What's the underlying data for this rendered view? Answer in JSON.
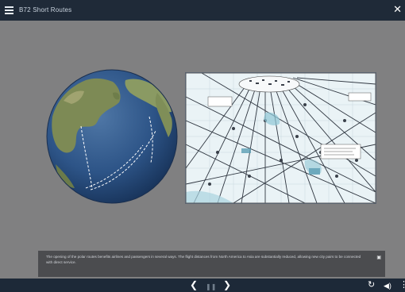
{
  "titlebar": {
    "title": "B72 Short Routes",
    "menu_icon": "hamburger-menu-icon",
    "close_icon": "close-icon",
    "close_glyph": "✕",
    "background": "#1f2a38"
  },
  "stage": {
    "background": "#808081",
    "globe": {
      "icon": "globe-pacific-routes-illustration"
    },
    "chart": {
      "icon": "polar-route-navigation-chart"
    }
  },
  "caption": {
    "text": "The opening of the polar routes benefits airlines and passengers in several ways. The flight distances from North America to Asia are substantially reduced, allowing new city pairs to be connected with direct service.",
    "icon": "transcript-icon",
    "icon_glyph": "▣"
  },
  "bottombar": {
    "prev_glyph": "❮",
    "pause_glyph": "❚❚",
    "next_glyph": "❯",
    "reload_glyph": "↻",
    "volume_glyph": "◀)",
    "more_glyph": "⋮",
    "icons": [
      "chevron-left-icon",
      "pause-icon",
      "chevron-right-icon",
      "reload-icon",
      "volume-icon",
      "more-vertical-icon"
    ],
    "background": "#1d2938"
  }
}
